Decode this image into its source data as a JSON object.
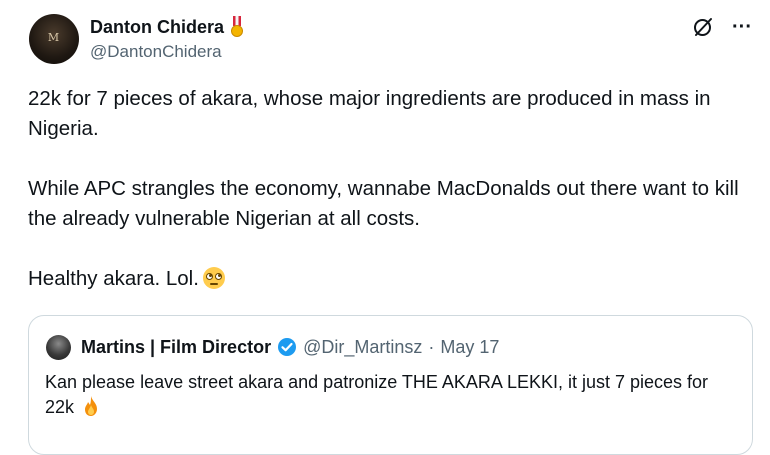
{
  "author": {
    "display_name": "Danton Chidera",
    "handle": "@DantonChidera",
    "badge_icon": "medal-icon",
    "avatar_monogram": "M"
  },
  "actions": {
    "grok_icon": "grok-icon",
    "more_icon": "more-icon",
    "more_label": "···"
  },
  "post": {
    "paragraph_1": "22k for 7 pieces of akara, whose major ingredients are produced in mass in Nigeria.",
    "paragraph_2": "While APC strangles the economy, wannabe MacDonalds out there want to kill the already vulnerable Nigerian at all costs.",
    "paragraph_3": "Healthy akara. Lol.",
    "paragraph_3_emoji": "face-with-rolling-eyes-emoji"
  },
  "quoted_post": {
    "display_name": "Martins | Film Director",
    "verified_icon": "verified-badge-icon",
    "verified_color": "#1d9bf0",
    "handle": "@Dir_Martinsz",
    "separator": "·",
    "date": "May 17",
    "text": "Kan please leave street akara and patronize THE AKARA LEKKI, it just 7 pieces for 22k",
    "text_emoji": "fire-emoji"
  },
  "colors": {
    "text_primary": "#0f1419",
    "text_secondary": "#536471",
    "border": "#cfd9de"
  }
}
